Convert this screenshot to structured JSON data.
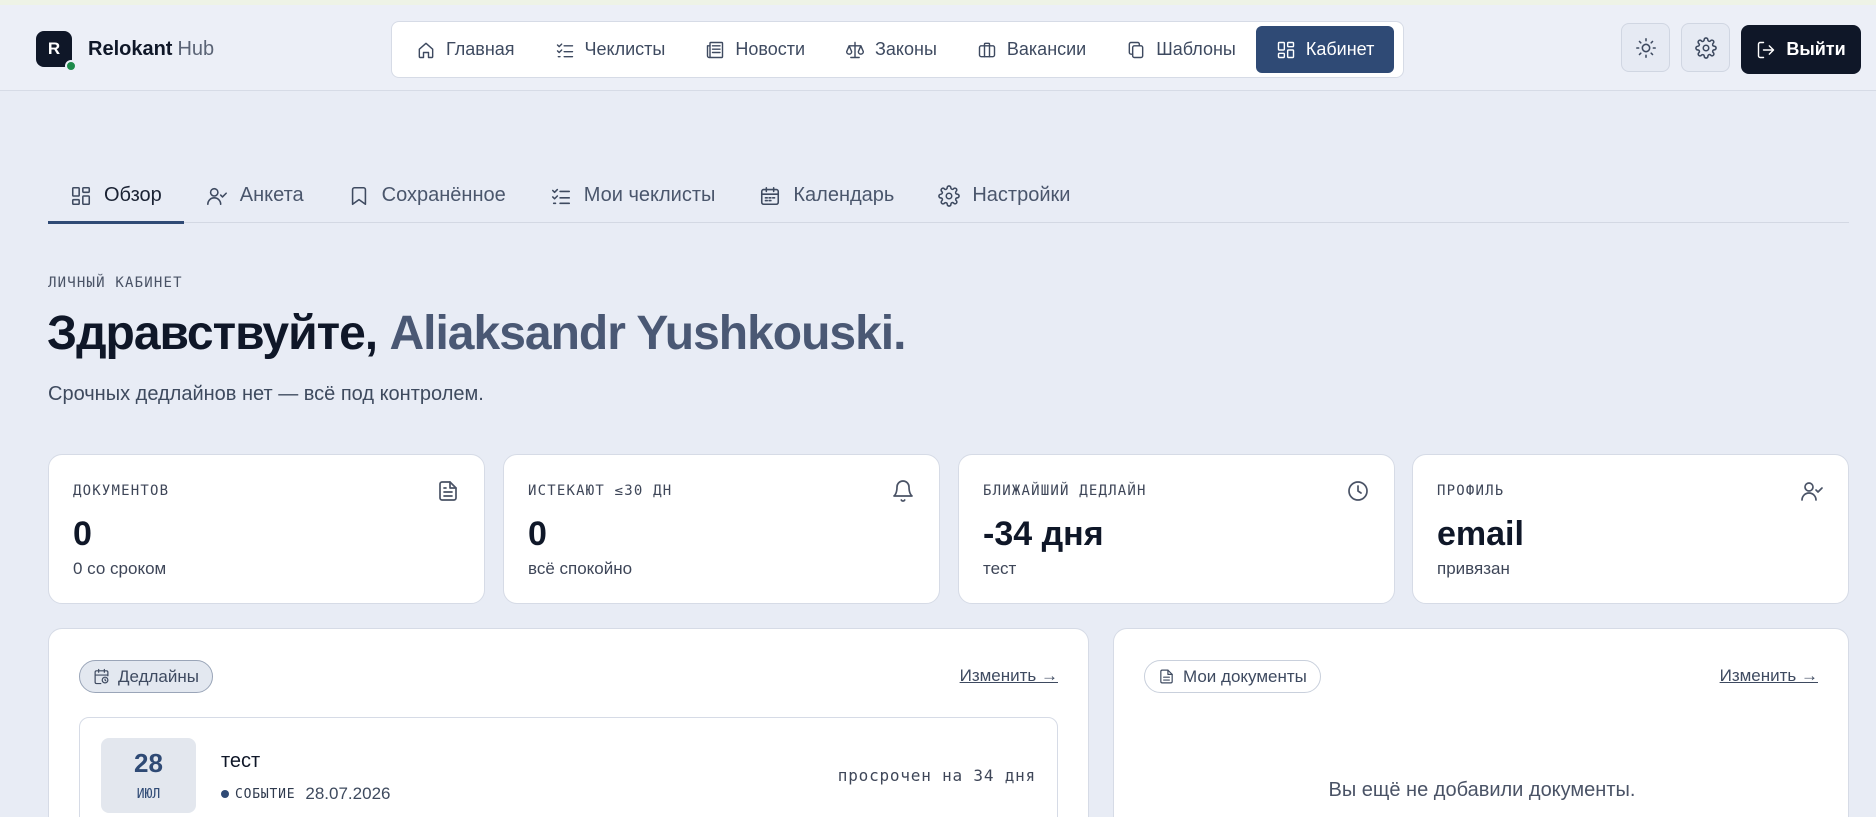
{
  "header": {
    "logo_letter": "R",
    "brand_strong": "Relokant",
    "brand_light": "Hub",
    "nav": [
      {
        "label": "Главная",
        "icon": "home-icon"
      },
      {
        "label": "Чеклисты",
        "icon": "checklist-icon"
      },
      {
        "label": "Новости",
        "icon": "newspaper-icon"
      },
      {
        "label": "Законы",
        "icon": "scales-icon"
      },
      {
        "label": "Вакансии",
        "icon": "briefcase-icon"
      },
      {
        "label": "Шаблоны",
        "icon": "copy-icon"
      },
      {
        "label": "Кабинет",
        "icon": "dashboard-icon",
        "active": true
      }
    ],
    "logout_label": "Выйти"
  },
  "tabs": [
    {
      "label": "Обзор",
      "icon": "dashboard-icon",
      "active": true
    },
    {
      "label": "Анкета",
      "icon": "user-check-icon"
    },
    {
      "label": "Сохранённое",
      "icon": "bookmark-icon"
    },
    {
      "label": "Мои чеклисты",
      "icon": "checklist-icon"
    },
    {
      "label": "Календарь",
      "icon": "calendar-icon"
    },
    {
      "label": "Настройки",
      "icon": "gear-icon"
    }
  ],
  "greeting": {
    "overline": "ЛИЧНЫЙ КАБИНЕТ",
    "hello": "Здравствуйте,",
    "name": "Aliaksandr Yushkouski.",
    "subline": "Срочных дедлайнов нет — всё под контролем."
  },
  "stats": [
    {
      "label": "ДОКУМЕНТОВ",
      "value": "0",
      "sub": "0 со сроком",
      "icon": "document-icon"
    },
    {
      "label": "ИСТЕКАЮТ ≤30 ДН",
      "value": "0",
      "sub": "всё спокойно",
      "icon": "bell-icon"
    },
    {
      "label": "БЛИЖАЙШИЙ ДЕДЛАЙН",
      "value": "-34 дня",
      "sub": "тест",
      "icon": "clock-icon"
    },
    {
      "label": "ПРОФИЛЬ",
      "value": "email",
      "sub": "привязан",
      "icon": "user-check-icon"
    }
  ],
  "deadlines": {
    "chip": "Дедлайны",
    "link": "Изменить →",
    "items": [
      {
        "day": "28",
        "month": "ИЮЛ",
        "title": "тест",
        "type": "СОБЫТИЕ",
        "date": "28.07.2026",
        "status": "просрочен на 34 дня"
      }
    ]
  },
  "documents": {
    "chip": "Мои документы",
    "link": "Изменить →",
    "empty": "Вы ещё не добавили документы."
  },
  "colors": {
    "accent": "#2f4a75",
    "dark": "#0f1728",
    "background": "#e8ecf5",
    "online": "#1d8a4a"
  }
}
